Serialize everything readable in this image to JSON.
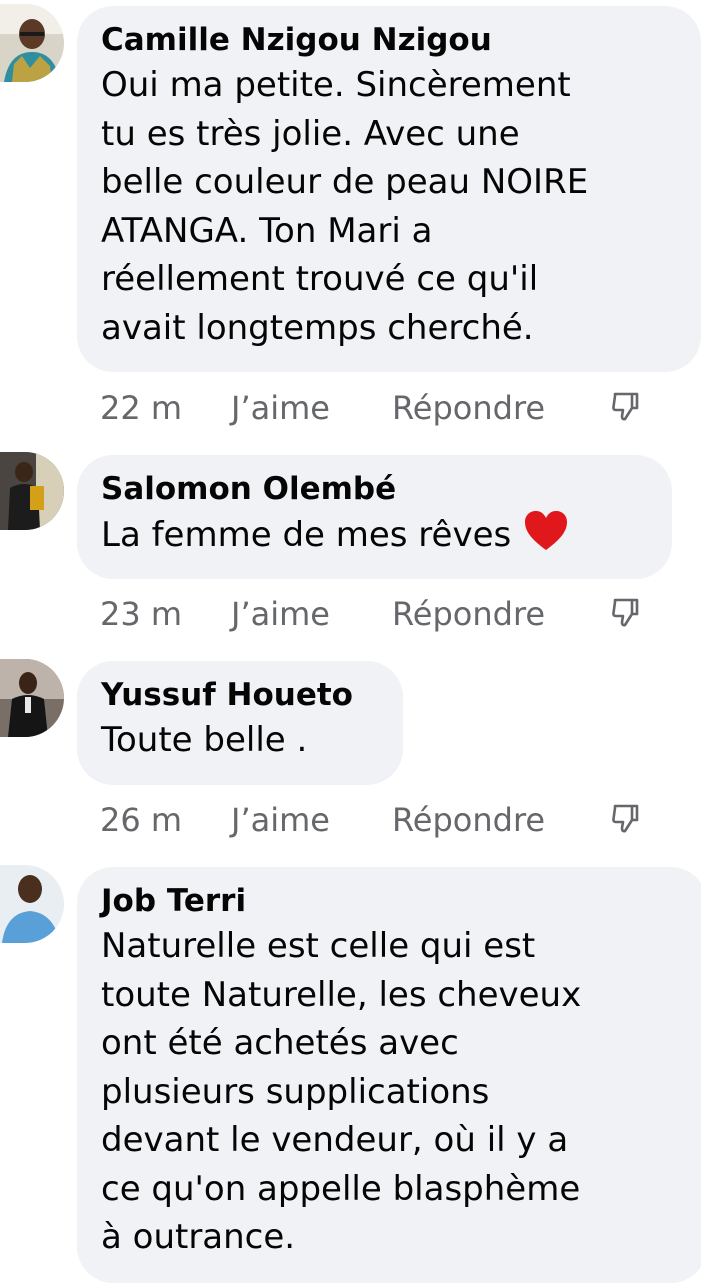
{
  "comments": [
    {
      "author": "Camille Nzigou Nzigou",
      "lines": [
        "Oui ma petite. Sincèrement",
        "tu es très jolie. Avec une",
        "belle couleur de peau NOIRE",
        "ATANGA. Ton Mari a",
        "réellement trouvé ce qu'il",
        "avait longtemps cherché."
      ],
      "time": "22 m",
      "like": "J’aime",
      "reply": "Répondre"
    },
    {
      "author": "Salomon Olembé",
      "lines": [
        "La femme de mes rêves"
      ],
      "emoji": "red-heart-icon",
      "time": "23 m",
      "like": "J’aime",
      "reply": "Répondre"
    },
    {
      "author": "Yussuf Houeto",
      "lines": [
        "Toute belle ."
      ],
      "time": "26 m",
      "like": "J’aime",
      "reply": "Répondre"
    },
    {
      "author": "Job Terri",
      "lines": [
        "Naturelle est celle qui est",
        "toute Naturelle, les cheveux",
        "ont été achetés avec",
        "plusieurs supplications",
        "devant le vendeur, où il y a",
        "ce qu'on appelle blasphème",
        "à outrance."
      ]
    }
  ],
  "colors": {
    "bubble": "#f0f2f5",
    "text": "#050505",
    "meta": "#65676b",
    "heart": "#e0181b"
  }
}
